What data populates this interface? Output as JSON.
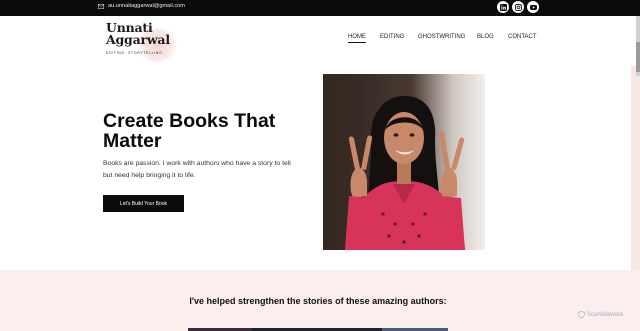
{
  "topbar": {
    "email": "au.unnatiaggarwal@gmail.com",
    "socials": [
      {
        "icon": "linkedin-icon"
      },
      {
        "icon": "instagram-icon"
      },
      {
        "icon": "youtube-icon"
      }
    ]
  },
  "logo": {
    "line1": "Unnati",
    "line2": "Aggarwal",
    "tagline": "EDITING. STORYTELLING."
  },
  "nav": {
    "items": [
      {
        "label": "HOME",
        "active": true
      },
      {
        "label": "EDITING"
      },
      {
        "label": "GHOSTWRITING"
      },
      {
        "label": "BLOG"
      },
      {
        "label": "CONTACT"
      }
    ]
  },
  "hero": {
    "title": "Create Books That Matter",
    "lead": "Books are passion. I work with authors who have a story to tell but need help bringing it to life.",
    "cta": "Let's Build Your Book"
  },
  "authors": {
    "heading": "I've helped strengthen the stories of these amazing authors:"
  },
  "watermark": "ScanMalware",
  "colors": {
    "topbar_bg": "#0b0b0b",
    "accent_pink": "#fbeeed",
    "shirt_pink": "#d8345a"
  }
}
